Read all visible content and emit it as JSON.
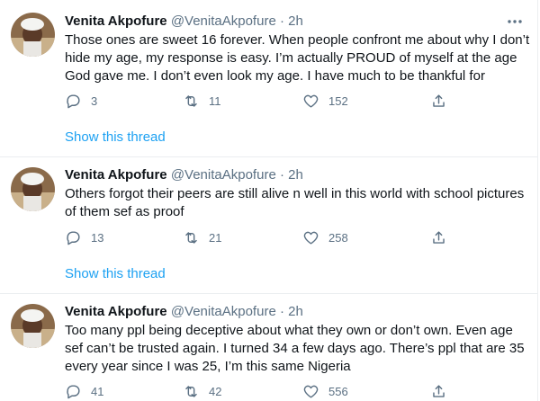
{
  "tweets": [
    {
      "name": "Venita Akpofure",
      "handle": "@VenitaAkpofure",
      "dot": "·",
      "time": "2h",
      "text": "Those ones are sweet 16 forever. When people confront me about why I don’t hide my age, my response is easy. I’m actually PROUD of myself at the age God gave me. I don’t even look my age. I have much to be thankful for",
      "replies": "3",
      "retweets": "11",
      "likes": "152",
      "thread_link": "Show this thread"
    },
    {
      "name": "Venita Akpofure",
      "handle": "@VenitaAkpofure",
      "dot": "·",
      "time": "2h",
      "text": "Others forgot their peers are still alive n well in this world with school pictures of them sef as proof",
      "replies": "13",
      "retweets": "21",
      "likes": "258",
      "thread_link": "Show this thread"
    },
    {
      "name": "Venita Akpofure",
      "handle": "@VenitaAkpofure",
      "dot": "·",
      "time": "2h",
      "text": "Too many ppl being deceptive about what they own or don’t own. Even age sef can’t be trusted again. I turned 34 a few days ago. There’s ppl that are 35 every year since I was 25, I’m this same Nigeria",
      "replies": "41",
      "retweets": "42",
      "likes": "556"
    }
  ],
  "icons": {
    "more": "more-horizontal-icon",
    "reply": "reply-bubble-icon",
    "retweet": "retweet-arrows-icon",
    "like": "heart-outline-icon",
    "share": "share-upload-icon"
  },
  "colors": {
    "text_primary": "#0f1419",
    "text_secondary": "#5b7083",
    "link": "#1da1f2",
    "divider": "#ebeef0"
  }
}
